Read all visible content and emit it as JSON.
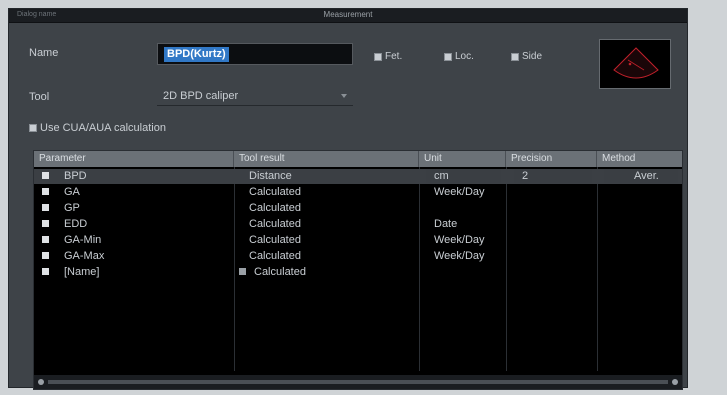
{
  "window": {
    "left_title": "Dialog name",
    "center_title": "Measurement"
  },
  "form": {
    "name_label": "Name",
    "name_value": "BPD(Kurtz)",
    "tool_label": "Tool",
    "tool_value": "2D BPD caliper",
    "checkboxes": [
      {
        "label": "Fet.",
        "checked": true
      },
      {
        "label": "Loc.",
        "checked": true
      },
      {
        "label": "Side",
        "checked": true
      }
    ],
    "use_calc_label": "Use CUA/AUA calculation",
    "use_calc_checked": true
  },
  "table": {
    "columns": [
      "Parameter",
      "Tool result",
      "Unit",
      "Precision",
      "Method"
    ],
    "rows": [
      {
        "checked": true,
        "parameter": "BPD",
        "tool_result": "Distance",
        "unit": "cm",
        "precision": "2",
        "method": "Aver.",
        "selected": true
      },
      {
        "checked": true,
        "parameter": "GA",
        "tool_result": "Calculated",
        "unit": "Week/Day",
        "precision": "",
        "method": ""
      },
      {
        "checked": true,
        "parameter": "GP",
        "tool_result": "Calculated",
        "unit": "",
        "precision": "",
        "method": ""
      },
      {
        "checked": true,
        "parameter": "EDD",
        "tool_result": "Calculated",
        "unit": "Date",
        "precision": "",
        "method": ""
      },
      {
        "checked": true,
        "parameter": "GA-Min",
        "tool_result": "Calculated",
        "unit": "Week/Day",
        "precision": "",
        "method": ""
      },
      {
        "checked": true,
        "parameter": "GA-Max",
        "tool_result": "Calculated",
        "unit": "Week/Day",
        "precision": "",
        "method": ""
      },
      {
        "checked": true,
        "parameter": "[Name]",
        "tool_result": "Calculated",
        "unit": "",
        "precision": "",
        "method": ""
      }
    ]
  }
}
